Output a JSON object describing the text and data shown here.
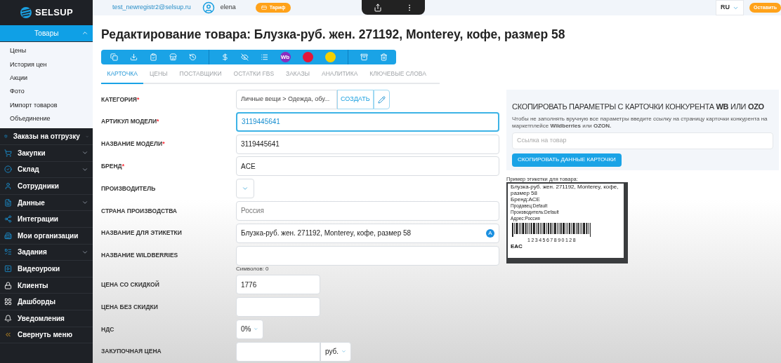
{
  "sidebar": {
    "logo": "SELSUP",
    "items": [
      {
        "label": "Товары",
        "selected": true,
        "expanded": true,
        "children": [
          {
            "label": "Цены"
          },
          {
            "label": "История цен"
          },
          {
            "label": "Акции"
          },
          {
            "label": "Фото"
          },
          {
            "label": "Импорт товаров"
          },
          {
            "label": "Объединение"
          }
        ]
      },
      {
        "label": "Заказы на отгрузку",
        "selected": false,
        "expanded": false
      },
      {
        "label": "Закупки",
        "selected": false,
        "expanded": false
      },
      {
        "label": "Склад",
        "selected": false,
        "expanded": false
      },
      {
        "label": "Сотрудники",
        "selected": false
      },
      {
        "label": "Данные",
        "selected": false,
        "expanded": false
      },
      {
        "label": "Интеграции",
        "selected": false
      },
      {
        "label": "Мои организации",
        "selected": false
      },
      {
        "label": "Задания",
        "selected": false,
        "expanded": false
      },
      {
        "label": "Видеоуроки",
        "selected": false
      },
      {
        "label": "Клиенты",
        "selected": false
      },
      {
        "label": "Дашборды",
        "selected": false
      },
      {
        "label": "Уведомления",
        "selected": false
      },
      {
        "label": "Свернуть меню",
        "selected": false
      }
    ]
  },
  "header": {
    "email": "test_newregistr2@selsup.ru",
    "user": "elena",
    "tariff": "Тариф",
    "language": "RU",
    "action": "Оставить"
  },
  "title": "Редактирование товара: Блузка-руб. жен. 271192, Monterey, кофе, размер 58",
  "toolbar": [
    {
      "kind": "icon"
    },
    {
      "kind": "icon"
    },
    {
      "kind": "icon"
    },
    {
      "kind": "icon"
    },
    {
      "kind": "icon"
    },
    {
      "kind": "divider"
    },
    {
      "kind": "icon"
    },
    {
      "kind": "icon"
    },
    {
      "kind": "icon"
    },
    {
      "kind": "badge",
      "label": "Wb",
      "color": "#8b2bbf"
    },
    {
      "kind": "badge",
      "color": "#e3163a"
    },
    {
      "kind": "badge",
      "color": "#f5d000"
    },
    {
      "kind": "divider"
    },
    {
      "kind": "icon"
    },
    {
      "kind": "icon"
    }
  ],
  "tabs": [
    {
      "label": "КАРТОЧКА",
      "selected": true
    },
    {
      "label": "ЦЕНЫ",
      "selected": false
    },
    {
      "label": "ПОСТАВЩИКИ",
      "selected": false
    },
    {
      "label": "ОСТАТКИ FBS",
      "selected": false
    },
    {
      "label": "ЗАКАЗЫ",
      "selected": false
    },
    {
      "label": "АНАЛИТИКА",
      "selected": false
    },
    {
      "label": "КЛЮЧЕВЫЕ СЛОВА",
      "selected": false
    }
  ],
  "required_mark": "*",
  "form": [
    {
      "kind": "category",
      "label": "КАТЕГОРИЯ",
      "required": true,
      "value": "Личные вещи > Одежда, обу...",
      "button": "СОЗДАТЬ"
    },
    {
      "kind": "input",
      "label": "АРТИКУЛ МОДЕЛИ",
      "required": true,
      "value": "3119445641",
      "focused": true
    },
    {
      "kind": "input",
      "label": "НАЗВАНИЕ МОДЕЛИ",
      "required": true,
      "value": "3119445641",
      "focused": false
    },
    {
      "kind": "input",
      "label": "БРЕНД",
      "required": true,
      "value": "ACE",
      "focused": false
    },
    {
      "kind": "dropdown",
      "label": "ПРОИЗВОДИТЕЛЬ",
      "required": false
    },
    {
      "kind": "input",
      "label": "СТРАНА ПРОИЗВОДСТВА",
      "required": false,
      "placeholder": "Россия"
    },
    {
      "kind": "badge_input",
      "label": "НАЗВАНИЕ ДЛЯ ЭТИКЕТКИ",
      "required": false,
      "value": "Блузка-руб. жен. 271192, Monterey, кофе, размер 58",
      "badge": "A"
    },
    {
      "kind": "textarea",
      "label": "НАЗВАНИЕ WILDBERRIES",
      "required": false,
      "counter": "Символов: 0"
    },
    {
      "kind": "short",
      "label": "ЦЕНА СО СКИДКОЙ",
      "required": false,
      "value": "1776"
    },
    {
      "kind": "short",
      "label": "ЦЕНА БЕЗ СКИДКИ",
      "required": false
    },
    {
      "kind": "select",
      "label": "НДС",
      "required": false,
      "value": "0%"
    },
    {
      "kind": "currency",
      "label": "ЗАКУПОЧНАЯ ЦЕНА",
      "required": false,
      "unit": "руб."
    }
  ],
  "competitor": {
    "title": "СКОПИРОВАТЬ ПАРАМЕТРЫ С КАРТОЧКИ КОНКУРЕНТА **WB** ИЛИ **OZO**",
    "description": "Чтобы не заполнять вручную все параметры введите ссылку на страницу карточки конкурента на маркетплейсе **Wildberries** или **OZON.**",
    "placeholder": "Ссылка на товар",
    "button": "СКОПИРОВАТЬ ДАННЫЕ КАРТОЧКИ"
  },
  "label_preview": {
    "caption": "Пример этикетки для товара:",
    "lines": [
      "Блузка-руб. жен. 271192, Monterey, кофе, размер 58",
      "Бренд:ACE",
      "Продавец:Default",
      "Производитель:Default",
      "Адрес:Россия"
    ],
    "barcode": "1234567890128",
    "mark": "EAC"
  }
}
